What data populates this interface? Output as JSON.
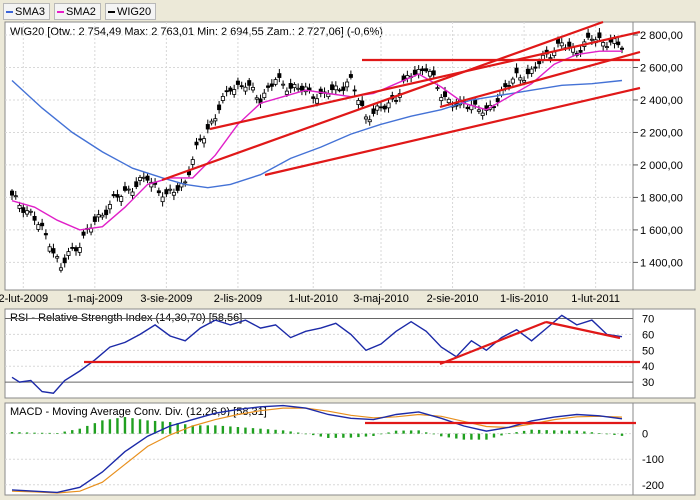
{
  "legend": [
    {
      "label": "SMA3",
      "color": "#3b64d8"
    },
    {
      "label": "SMA2",
      "color": "#e81ec8"
    },
    {
      "label": "WIG20",
      "color": "#000000"
    }
  ],
  "colors": {
    "sma_slow": "#4472d6",
    "sma_fast": "#e020c8",
    "trend": "#e01818",
    "macd": "#1c2aa8",
    "signal": "#e8901e",
    "hist": "#20a020",
    "rsi": "#1c2aa8"
  },
  "price_panel": {
    "header": "WIG20 [Otw.: 2 754,49  Max: 2 763,01  Min: 2 694,55  Zam.: 2 727,06] (-0,6%)",
    "y_ticks": [
      "2 800,00",
      "2 600,00",
      "2 400,00",
      "2 200,00",
      "2 000,00",
      "1 800,00",
      "1 600,00",
      "1 400,00"
    ],
    "x_ticks": [
      "2-lut-2009",
      "1-maj-2009",
      "3-sie-2009",
      "2-lis-2009",
      "1-lut-2010",
      "3-maj-2010",
      "2-sie-2010",
      "1-lis-2010",
      "1-lut-2011"
    ]
  },
  "rsi_panel": {
    "header": "RSI - Relative Strength Index (14,30,70) [58,56]",
    "y_ticks": [
      "70",
      "60",
      "50",
      "40",
      "30"
    ]
  },
  "macd_panel": {
    "header": "MACD - Moving Average Conv. Div. (12,26,9) [58,31]",
    "y_ticks": [
      "0",
      "-100",
      "-200"
    ]
  },
  "chart_data": [
    {
      "type": "candlestick",
      "title": "WIG20",
      "x_ticks": [
        "2-lut-2009",
        "1-maj-2009",
        "3-sie-2009",
        "2-lis-2009",
        "1-lut-2010",
        "3-maj-2010",
        "2-sie-2010",
        "1-lis-2010",
        "1-lut-2011"
      ],
      "ylim": [
        1230,
        2880
      ],
      "series": [
        {
          "name": "WIG20",
          "close_x_y": [
            [
              0,
              1800
            ],
            [
              5,
              1700
            ],
            [
              10,
              1530
            ],
            [
              13,
              1360
            ],
            [
              15,
              1450
            ],
            [
              18,
              1520
            ],
            [
              22,
              1650
            ],
            [
              27,
              1780
            ],
            [
              31,
              1850
            ],
            [
              36,
              1920
            ],
            [
              41,
              1800
            ],
            [
              46,
              1900
            ],
            [
              50,
              2150
            ],
            [
              54,
              2300
            ],
            [
              58,
              2480
            ],
            [
              62,
              2490
            ],
            [
              66,
              2410
            ],
            [
              70,
              2520
            ],
            [
              74,
              2480
            ],
            [
              78,
              2460
            ],
            [
              82,
              2420
            ],
            [
              86,
              2470
            ],
            [
              90,
              2510
            ],
            [
              94,
              2300
            ],
            [
              98,
              2340
            ],
            [
              102,
              2420
            ],
            [
              106,
              2560
            ],
            [
              110,
              2600
            ],
            [
              114,
              2440
            ],
            [
              118,
              2360
            ],
            [
              122,
              2380
            ],
            [
              126,
              2310
            ],
            [
              130,
              2450
            ],
            [
              134,
              2540
            ],
            [
              138,
              2570
            ],
            [
              142,
              2680
            ],
            [
              146,
              2740
            ],
            [
              150,
              2700
            ],
            [
              154,
              2780
            ],
            [
              158,
              2760
            ],
            [
              162,
              2727
            ]
          ]
        },
        {
          "name": "SMA3",
          "x_y": [
            [
              0,
              2520
            ],
            [
              8,
              2350
            ],
            [
              16,
              2200
            ],
            [
              24,
              2080
            ],
            [
              32,
              1980
            ],
            [
              40,
              1920
            ],
            [
              46,
              1880
            ],
            [
              52,
              1860
            ],
            [
              58,
              1880
            ],
            [
              66,
              1940
            ],
            [
              74,
              2040
            ],
            [
              82,
              2110
            ],
            [
              90,
              2190
            ],
            [
              98,
              2250
            ],
            [
              106,
              2300
            ],
            [
              114,
              2340
            ],
            [
              122,
              2400
            ],
            [
              130,
              2430
            ],
            [
              138,
              2460
            ],
            [
              146,
              2490
            ],
            [
              154,
              2500
            ],
            [
              162,
              2520
            ]
          ]
        },
        {
          "name": "SMA2",
          "x_y": [
            [
              0,
              1780
            ],
            [
              6,
              1740
            ],
            [
              12,
              1660
            ],
            [
              18,
              1600
            ],
            [
              24,
              1620
            ],
            [
              30,
              1740
            ],
            [
              36,
              1880
            ],
            [
              42,
              1920
            ],
            [
              48,
              1920
            ],
            [
              54,
              2060
            ],
            [
              60,
              2250
            ],
            [
              66,
              2380
            ],
            [
              72,
              2420
            ],
            [
              78,
              2460
            ],
            [
              84,
              2440
            ],
            [
              90,
              2420
            ],
            [
              96,
              2440
            ],
            [
              102,
              2500
            ],
            [
              108,
              2560
            ],
            [
              114,
              2480
            ],
            [
              120,
              2380
            ],
            [
              126,
              2340
            ],
            [
              132,
              2420
            ],
            [
              138,
              2500
            ],
            [
              144,
              2620
            ],
            [
              150,
              2680
            ],
            [
              156,
              2700
            ],
            [
              162,
              2700
            ]
          ]
        }
      ]
    },
    {
      "type": "line",
      "title": "RSI - Relative Strength Index (14,30,70) [58,56]",
      "ylim": [
        20,
        76
      ],
      "series": [
        {
          "name": "RSI",
          "x_y": [
            [
              0,
              33
            ],
            [
              2,
              30
            ],
            [
              5,
              31
            ],
            [
              8,
              24
            ],
            [
              11,
              23
            ],
            [
              14,
              31
            ],
            [
              18,
              37
            ],
            [
              22,
              44
            ],
            [
              26,
              52
            ],
            [
              30,
              55
            ],
            [
              34,
              60
            ],
            [
              38,
              66
            ],
            [
              42,
              59
            ],
            [
              46,
              56
            ],
            [
              50,
              64
            ],
            [
              54,
              69
            ],
            [
              58,
              66
            ],
            [
              62,
              69
            ],
            [
              66,
              64
            ],
            [
              70,
              66
            ],
            [
              74,
              58
            ],
            [
              78,
              62
            ],
            [
              82,
              64
            ],
            [
              86,
              67
            ],
            [
              90,
              60
            ],
            [
              94,
              50
            ],
            [
              98,
              54
            ],
            [
              102,
              62
            ],
            [
              106,
              68
            ],
            [
              110,
              62
            ],
            [
              114,
              52
            ],
            [
              118,
              46
            ],
            [
              122,
              56
            ],
            [
              126,
              50
            ],
            [
              130,
              58
            ],
            [
              134,
              63
            ],
            [
              138,
              56
            ],
            [
              142,
              64
            ],
            [
              146,
              72
            ],
            [
              150,
              66
            ],
            [
              154,
              69
            ],
            [
              158,
              60
            ],
            [
              162,
              58.56
            ]
          ]
        }
      ]
    },
    {
      "type": "line",
      "title": "MACD - Moving Average Conv. Div. (12,26,9) [58,31]",
      "ylim": [
        -240,
        120
      ],
      "series": [
        {
          "name": "MACD",
          "x_y": [
            [
              0,
              -220
            ],
            [
              6,
              -225
            ],
            [
              12,
              -230
            ],
            [
              18,
              -210
            ],
            [
              24,
              -150
            ],
            [
              30,
              -70
            ],
            [
              36,
              -10
            ],
            [
              42,
              30
            ],
            [
              48,
              55
            ],
            [
              54,
              80
            ],
            [
              60,
              95
            ],
            [
              66,
              105
            ],
            [
              72,
              110
            ],
            [
              78,
              100
            ],
            [
              84,
              75
            ],
            [
              90,
              60
            ],
            [
              96,
              55
            ],
            [
              102,
              75
            ],
            [
              108,
              85
            ],
            [
              114,
              60
            ],
            [
              120,
              30
            ],
            [
              126,
              10
            ],
            [
              132,
              25
            ],
            [
              138,
              50
            ],
            [
              144,
              65
            ],
            [
              150,
              75
            ],
            [
              156,
              70
            ],
            [
              162,
              58.31
            ]
          ]
        },
        {
          "name": "Signal",
          "x_y": [
            [
              0,
              -225
            ],
            [
              6,
              -228
            ],
            [
              12,
              -232
            ],
            [
              18,
              -225
            ],
            [
              24,
              -190
            ],
            [
              30,
              -120
            ],
            [
              36,
              -50
            ],
            [
              42,
              -5
            ],
            [
              48,
              30
            ],
            [
              54,
              55
            ],
            [
              60,
              75
            ],
            [
              66,
              90
            ],
            [
              72,
              100
            ],
            [
              78,
              100
            ],
            [
              84,
              88
            ],
            [
              90,
              72
            ],
            [
              96,
              62
            ],
            [
              102,
              66
            ],
            [
              108,
              75
            ],
            [
              114,
              68
            ],
            [
              120,
              48
            ],
            [
              126,
              28
            ],
            [
              132,
              24
            ],
            [
              138,
              38
            ],
            [
              144,
              55
            ],
            [
              150,
              66
            ],
            [
              156,
              68
            ],
            [
              162,
              65
            ]
          ]
        }
      ]
    }
  ]
}
